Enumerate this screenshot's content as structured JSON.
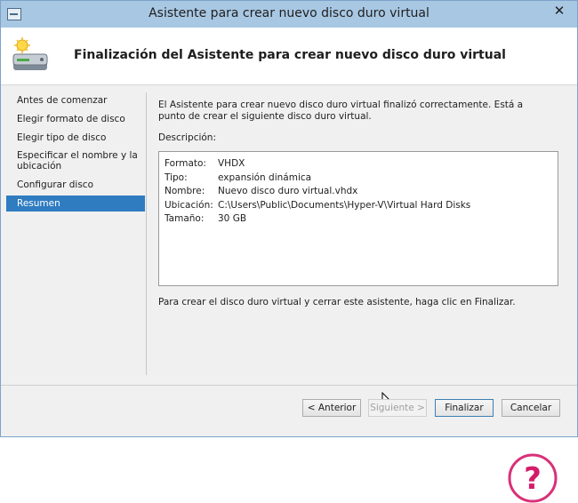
{
  "window": {
    "title": "Asistente para crear nuevo disco duro virtual",
    "close_glyph": "✕"
  },
  "header": {
    "title": "Finalización del Asistente para crear nuevo disco duro virtual",
    "icon": "virtual-disk-sparkle-icon"
  },
  "sidebar": {
    "items": [
      {
        "label": "Antes de comenzar"
      },
      {
        "label": "Elegir formato de disco"
      },
      {
        "label": "Elegir tipo de disco"
      },
      {
        "label": "Especificar el nombre y la ubicación"
      },
      {
        "label": "Configurar disco"
      },
      {
        "label": "Resumen",
        "selected": true
      }
    ]
  },
  "content": {
    "intro": "El Asistente para crear nuevo disco duro virtual finalizó correctamente. Está a punto de crear el siguiente disco duro virtual.",
    "description_label": "Descripción:",
    "details": [
      {
        "key": "Formato:",
        "value": "VHDX"
      },
      {
        "key": "Tipo:",
        "value": "expansión dinámica"
      },
      {
        "key": "Nombre:",
        "value": "Nuevo disco duro virtual.vhdx"
      },
      {
        "key": "Ubicación:",
        "value": "C:\\Users\\Public\\Documents\\Hyper-V\\Virtual Hard Disks"
      },
      {
        "key": "Tamaño:",
        "value": "30 GB"
      }
    ],
    "finish_instruction": "Para crear el disco duro virtual y cerrar este asistente, haga clic en Finalizar."
  },
  "buttons": {
    "previous": "< Anterior",
    "next": "Siguiente >",
    "finish": "Finalizar",
    "cancel": "Cancelar"
  },
  "colors": {
    "titlebar": "#a8c7e3",
    "selected_nav": "#2f7cc1",
    "watermark": "#d41b6a"
  }
}
